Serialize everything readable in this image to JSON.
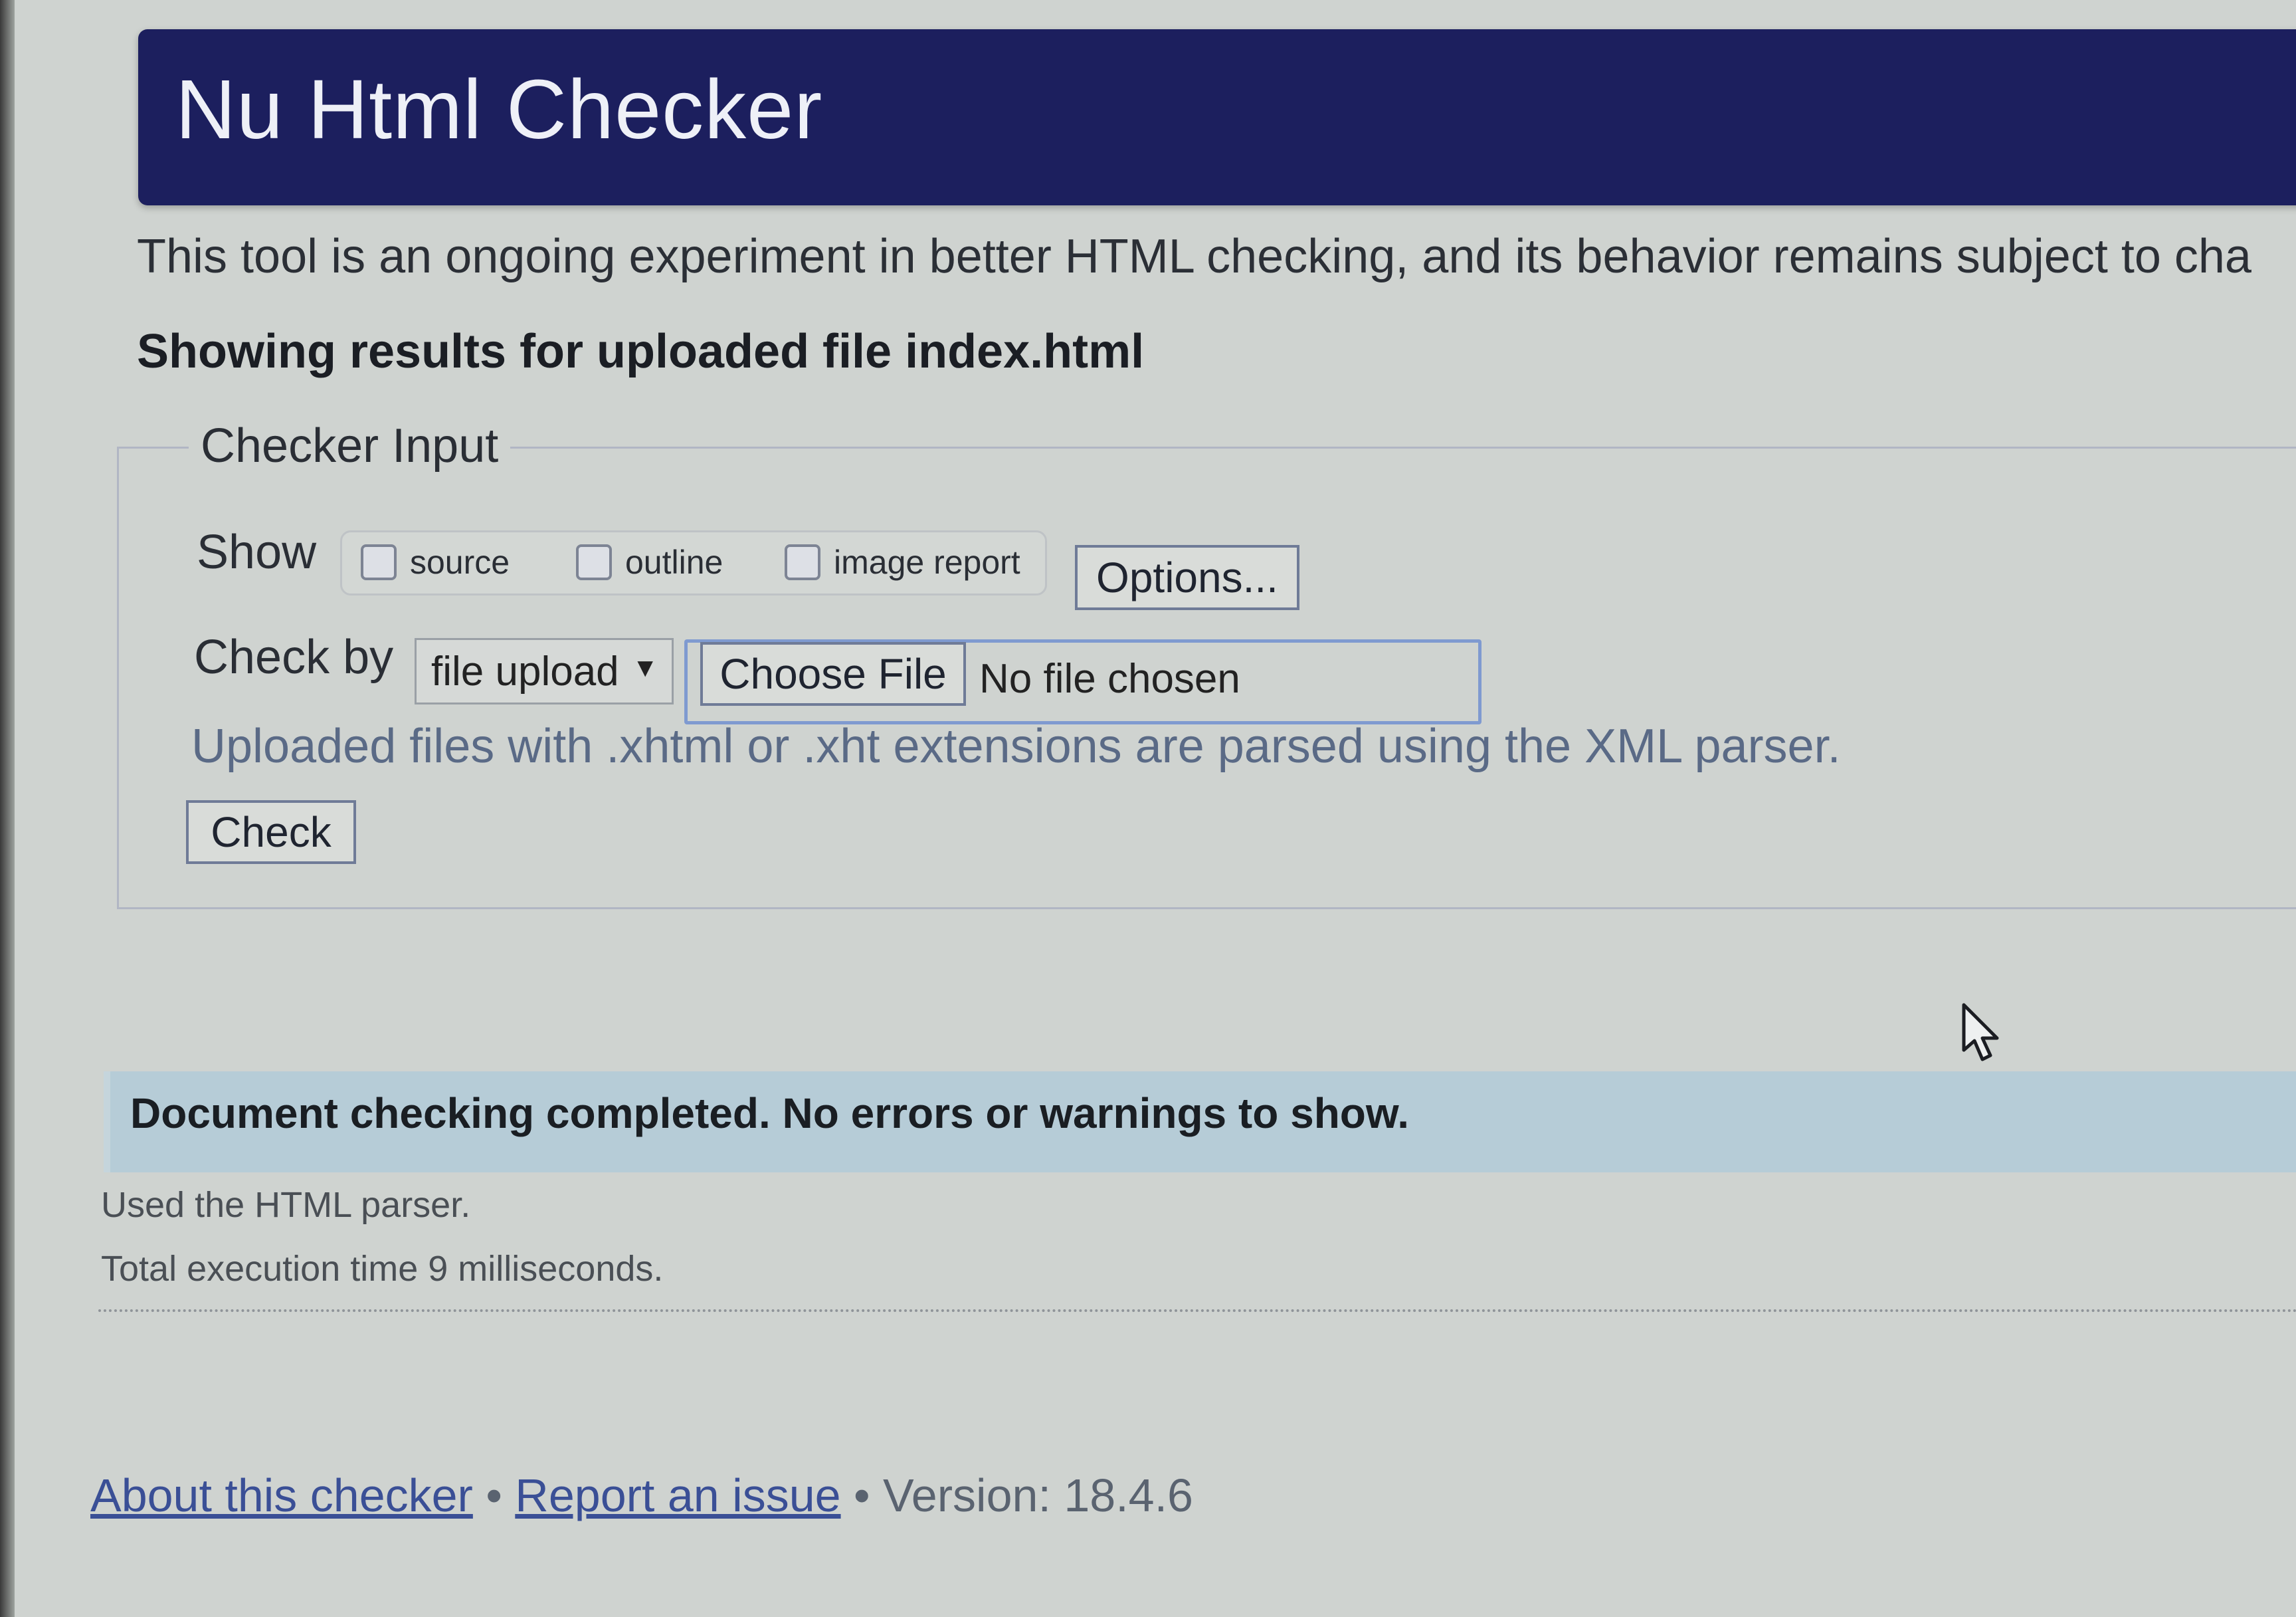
{
  "header": {
    "title": "Nu Html Checker"
  },
  "intro": "This tool is an ongoing experiment in better HTML checking, and its behavior remains subject to cha",
  "results_heading": "Showing results for uploaded file index.html",
  "checker_input": {
    "legend": "Checker Input",
    "show_label": "Show",
    "show_options": [
      {
        "label": "source",
        "checked": false
      },
      {
        "label": "outline",
        "checked": false
      },
      {
        "label": "image report",
        "checked": false
      }
    ],
    "options_button": "Options...",
    "check_by_label": "Check by",
    "check_by_selected": "file upload",
    "choose_file_button": "Choose File",
    "file_status": "No file chosen",
    "hint": "Uploaded files with .xhtml or .xht extensions are parsed using the XML parser.",
    "check_button": "Check"
  },
  "result": {
    "message": "Document checking completed. No errors or warnings to show.",
    "parser_info": "Used the HTML parser.",
    "execution_time": "Total execution time 9 milliseconds."
  },
  "footer": {
    "about_link": "About this checker",
    "separator": "•",
    "report_link": "Report an issue",
    "version": "Version: 18.4.6"
  },
  "colors": {
    "header_bg": "#1c1f5e",
    "success_bg": "#b6ccd7",
    "link": "#3a4f96"
  }
}
